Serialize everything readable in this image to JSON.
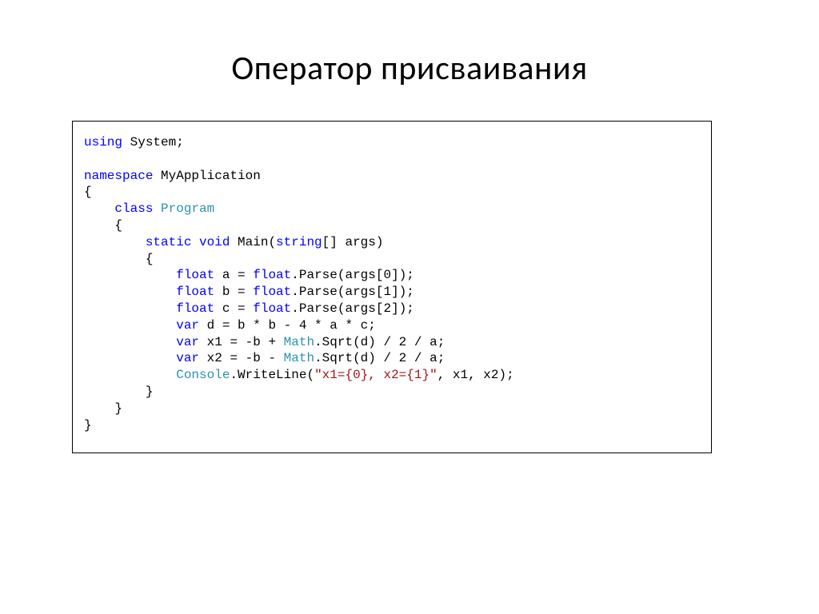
{
  "title": "Оператор присваивания",
  "code": {
    "kw_using": "using",
    "system_semi": " System;",
    "blank1": " ",
    "kw_namespace": "namespace",
    "myapp": " MyApplication",
    "open1": "{",
    "indent1_open": "    ",
    "kw_class": "class",
    "space1": " ",
    "t_program": "Program",
    "open2": "    {",
    "indent2": "        ",
    "kw_static": "static",
    "space2": " ",
    "kw_void": "void",
    "main_open": " Main(",
    "kw_string": "string",
    "args_close": "[] args)",
    "open3": "        {",
    "indent3": "            ",
    "kw_float1": "float",
    "a_eq": " a = ",
    "kw_float1b": "float",
    "parse0": ".Parse(args[0]);",
    "kw_float2": "float",
    "b_eq": " b = ",
    "kw_float2b": "float",
    "parse1": ".Parse(args[1]);",
    "kw_float3": "float",
    "c_eq": " c = ",
    "kw_float3b": "float",
    "parse2": ".Parse(args[2]);",
    "kw_var1": "var",
    "d_expr": " d = b * b - 4 * a * c;",
    "kw_var2": "var",
    "x1_pre": " x1 = -b + ",
    "t_math1": "Math",
    "x1_post": ".Sqrt(d) / 2 / a;",
    "kw_var3": "var",
    "x2_pre": " x2 = -b - ",
    "t_math2": "Math",
    "x2_post": ".Sqrt(d) / 2 / a;",
    "t_console": "Console",
    "writeline_open": ".WriteLine(",
    "str_fmt": "\"x1={0}, x2={1}\"",
    "writeline_close": ", x1, x2);",
    "close3": "        }",
    "close2": "    }",
    "close1": "}"
  }
}
